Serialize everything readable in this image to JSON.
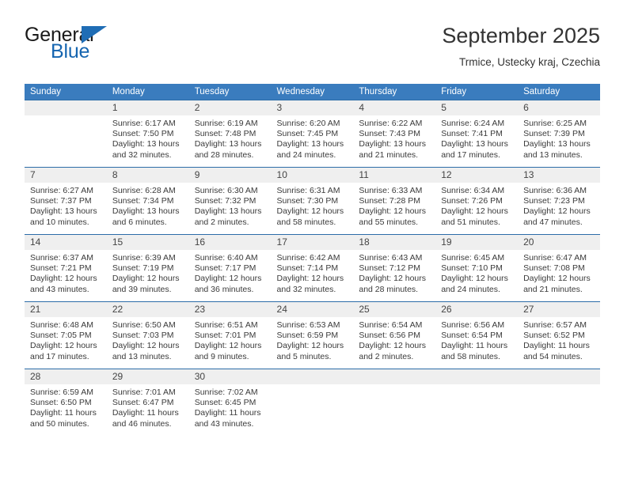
{
  "brand": {
    "name_part1": "General",
    "name_part2": "Blue",
    "triangle_color": "#1f6db5",
    "blue_color": "#1565b0"
  },
  "header": {
    "title": "September 2025",
    "subtitle": "Trmice, Ustecky kraj, Czechia"
  },
  "theme": {
    "header_bg": "#3a7cbe",
    "row_divider": "#2c6ca8",
    "daynum_bg": "#efefef"
  },
  "weekdays": [
    "Sunday",
    "Monday",
    "Tuesday",
    "Wednesday",
    "Thursday",
    "Friday",
    "Saturday"
  ],
  "weeks": [
    [
      {
        "day": "",
        "lines": []
      },
      {
        "day": "1",
        "lines": [
          "Sunrise: 6:17 AM",
          "Sunset: 7:50 PM",
          "Daylight: 13 hours",
          "and 32 minutes."
        ]
      },
      {
        "day": "2",
        "lines": [
          "Sunrise: 6:19 AM",
          "Sunset: 7:48 PM",
          "Daylight: 13 hours",
          "and 28 minutes."
        ]
      },
      {
        "day": "3",
        "lines": [
          "Sunrise: 6:20 AM",
          "Sunset: 7:45 PM",
          "Daylight: 13 hours",
          "and 24 minutes."
        ]
      },
      {
        "day": "4",
        "lines": [
          "Sunrise: 6:22 AM",
          "Sunset: 7:43 PM",
          "Daylight: 13 hours",
          "and 21 minutes."
        ]
      },
      {
        "day": "5",
        "lines": [
          "Sunrise: 6:24 AM",
          "Sunset: 7:41 PM",
          "Daylight: 13 hours",
          "and 17 minutes."
        ]
      },
      {
        "day": "6",
        "lines": [
          "Sunrise: 6:25 AM",
          "Sunset: 7:39 PM",
          "Daylight: 13 hours",
          "and 13 minutes."
        ]
      }
    ],
    [
      {
        "day": "7",
        "lines": [
          "Sunrise: 6:27 AM",
          "Sunset: 7:37 PM",
          "Daylight: 13 hours",
          "and 10 minutes."
        ]
      },
      {
        "day": "8",
        "lines": [
          "Sunrise: 6:28 AM",
          "Sunset: 7:34 PM",
          "Daylight: 13 hours",
          "and 6 minutes."
        ]
      },
      {
        "day": "9",
        "lines": [
          "Sunrise: 6:30 AM",
          "Sunset: 7:32 PM",
          "Daylight: 13 hours",
          "and 2 minutes."
        ]
      },
      {
        "day": "10",
        "lines": [
          "Sunrise: 6:31 AM",
          "Sunset: 7:30 PM",
          "Daylight: 12 hours",
          "and 58 minutes."
        ]
      },
      {
        "day": "11",
        "lines": [
          "Sunrise: 6:33 AM",
          "Sunset: 7:28 PM",
          "Daylight: 12 hours",
          "and 55 minutes."
        ]
      },
      {
        "day": "12",
        "lines": [
          "Sunrise: 6:34 AM",
          "Sunset: 7:26 PM",
          "Daylight: 12 hours",
          "and 51 minutes."
        ]
      },
      {
        "day": "13",
        "lines": [
          "Sunrise: 6:36 AM",
          "Sunset: 7:23 PM",
          "Daylight: 12 hours",
          "and 47 minutes."
        ]
      }
    ],
    [
      {
        "day": "14",
        "lines": [
          "Sunrise: 6:37 AM",
          "Sunset: 7:21 PM",
          "Daylight: 12 hours",
          "and 43 minutes."
        ]
      },
      {
        "day": "15",
        "lines": [
          "Sunrise: 6:39 AM",
          "Sunset: 7:19 PM",
          "Daylight: 12 hours",
          "and 39 minutes."
        ]
      },
      {
        "day": "16",
        "lines": [
          "Sunrise: 6:40 AM",
          "Sunset: 7:17 PM",
          "Daylight: 12 hours",
          "and 36 minutes."
        ]
      },
      {
        "day": "17",
        "lines": [
          "Sunrise: 6:42 AM",
          "Sunset: 7:14 PM",
          "Daylight: 12 hours",
          "and 32 minutes."
        ]
      },
      {
        "day": "18",
        "lines": [
          "Sunrise: 6:43 AM",
          "Sunset: 7:12 PM",
          "Daylight: 12 hours",
          "and 28 minutes."
        ]
      },
      {
        "day": "19",
        "lines": [
          "Sunrise: 6:45 AM",
          "Sunset: 7:10 PM",
          "Daylight: 12 hours",
          "and 24 minutes."
        ]
      },
      {
        "day": "20",
        "lines": [
          "Sunrise: 6:47 AM",
          "Sunset: 7:08 PM",
          "Daylight: 12 hours",
          "and 21 minutes."
        ]
      }
    ],
    [
      {
        "day": "21",
        "lines": [
          "Sunrise: 6:48 AM",
          "Sunset: 7:05 PM",
          "Daylight: 12 hours",
          "and 17 minutes."
        ]
      },
      {
        "day": "22",
        "lines": [
          "Sunrise: 6:50 AM",
          "Sunset: 7:03 PM",
          "Daylight: 12 hours",
          "and 13 minutes."
        ]
      },
      {
        "day": "23",
        "lines": [
          "Sunrise: 6:51 AM",
          "Sunset: 7:01 PM",
          "Daylight: 12 hours",
          "and 9 minutes."
        ]
      },
      {
        "day": "24",
        "lines": [
          "Sunrise: 6:53 AM",
          "Sunset: 6:59 PM",
          "Daylight: 12 hours",
          "and 5 minutes."
        ]
      },
      {
        "day": "25",
        "lines": [
          "Sunrise: 6:54 AM",
          "Sunset: 6:56 PM",
          "Daylight: 12 hours",
          "and 2 minutes."
        ]
      },
      {
        "day": "26",
        "lines": [
          "Sunrise: 6:56 AM",
          "Sunset: 6:54 PM",
          "Daylight: 11 hours",
          "and 58 minutes."
        ]
      },
      {
        "day": "27",
        "lines": [
          "Sunrise: 6:57 AM",
          "Sunset: 6:52 PM",
          "Daylight: 11 hours",
          "and 54 minutes."
        ]
      }
    ],
    [
      {
        "day": "28",
        "lines": [
          "Sunrise: 6:59 AM",
          "Sunset: 6:50 PM",
          "Daylight: 11 hours",
          "and 50 minutes."
        ]
      },
      {
        "day": "29",
        "lines": [
          "Sunrise: 7:01 AM",
          "Sunset: 6:47 PM",
          "Daylight: 11 hours",
          "and 46 minutes."
        ]
      },
      {
        "day": "30",
        "lines": [
          "Sunrise: 7:02 AM",
          "Sunset: 6:45 PM",
          "Daylight: 11 hours",
          "and 43 minutes."
        ]
      },
      {
        "day": "",
        "lines": []
      },
      {
        "day": "",
        "lines": []
      },
      {
        "day": "",
        "lines": []
      },
      {
        "day": "",
        "lines": []
      }
    ]
  ]
}
